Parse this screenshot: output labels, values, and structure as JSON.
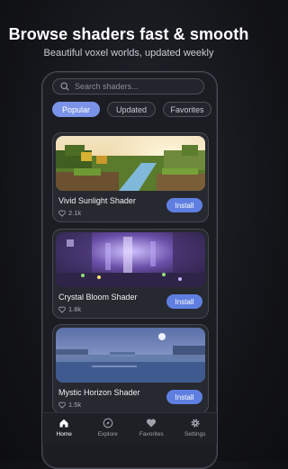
{
  "promo": {
    "headline": "Browse shaders fast & smooth",
    "subline": "Beautiful voxel worlds, updated weekly"
  },
  "search": {
    "placeholder": "Search shaders..."
  },
  "tabs": [
    {
      "label": "Popular",
      "active": true
    },
    {
      "label": "Updated",
      "active": false
    },
    {
      "label": "Favorites",
      "active": false
    }
  ],
  "cards": [
    {
      "title": "Vivid Sunlight Shader",
      "likes": "2.1k",
      "button": "Install"
    },
    {
      "title": "Crystal Bloom Shader",
      "likes": "1.8k",
      "button": "Install"
    },
    {
      "title": "Mystic Horizon Shader",
      "likes": "1.5k",
      "button": "Install"
    }
  ],
  "nav": [
    {
      "label": "Home",
      "icon": "home-icon",
      "active": true
    },
    {
      "label": "Explore",
      "icon": "compass-icon",
      "active": false
    },
    {
      "label": "Favorites",
      "icon": "heart-icon",
      "active": false
    },
    {
      "label": "Settings",
      "icon": "gear-icon",
      "active": false
    }
  ],
  "colors": {
    "accent": "#7a93e8",
    "install": "#5f7fe0",
    "background": "#121317"
  }
}
